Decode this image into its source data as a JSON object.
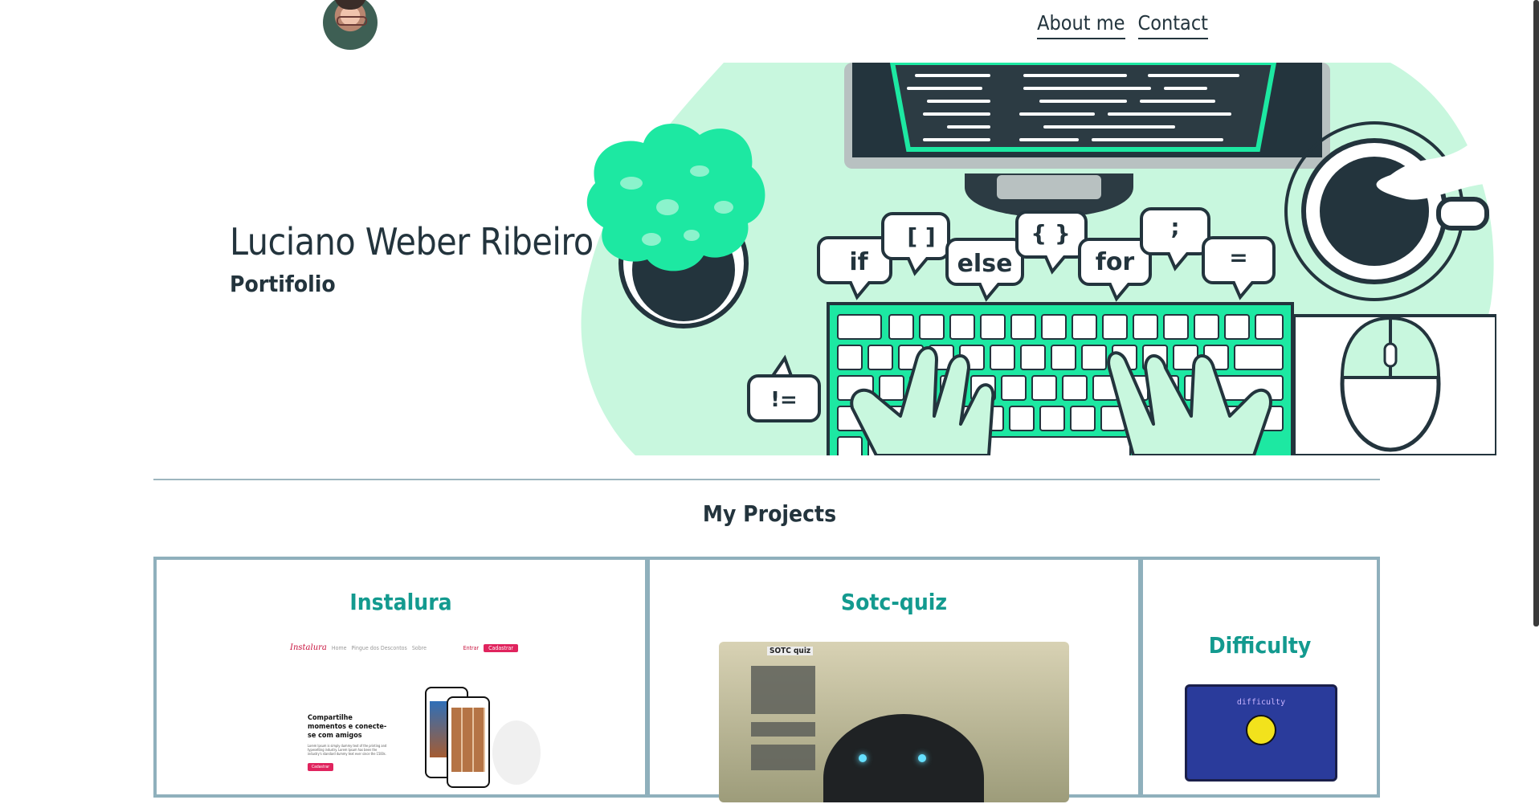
{
  "nav": {
    "about": "About me",
    "contact": "Contact"
  },
  "hero": {
    "name": "Luciano Weber Ribeiro",
    "subtitle": "Portifolio",
    "bubbles": [
      "if",
      "[ ]",
      "else",
      "{ }",
      "for",
      ";",
      "=",
      "!="
    ]
  },
  "section": {
    "title": "My Projects"
  },
  "projects": [
    {
      "title": "Instalura",
      "preview": {
        "logo": "Instalura",
        "links": [
          "Home",
          "Pingue dos Descontos",
          "Sobre"
        ],
        "login": "Entrar",
        "signup": "Cadastrar",
        "headline": "Compartilhe momentos e conecte-se com amigos",
        "body": "Lorem Ipsum is simply dummy text of the printing and typesetting industry. Lorem Ipsum has been the industry's standard dummy text ever since the 1500s.",
        "cta": "Cadastrar"
      }
    },
    {
      "title": "Sotc-quiz",
      "preview": {
        "logo": "SOTC quiz"
      }
    },
    {
      "title": "Difficulty",
      "preview": {
        "logo": "difficulty"
      }
    }
  ],
  "colors": {
    "accent": "#139a8f",
    "dark": "#23343d",
    "mint": "#c8f7de",
    "green": "#1de8a2",
    "border": "#8fb0bc"
  }
}
